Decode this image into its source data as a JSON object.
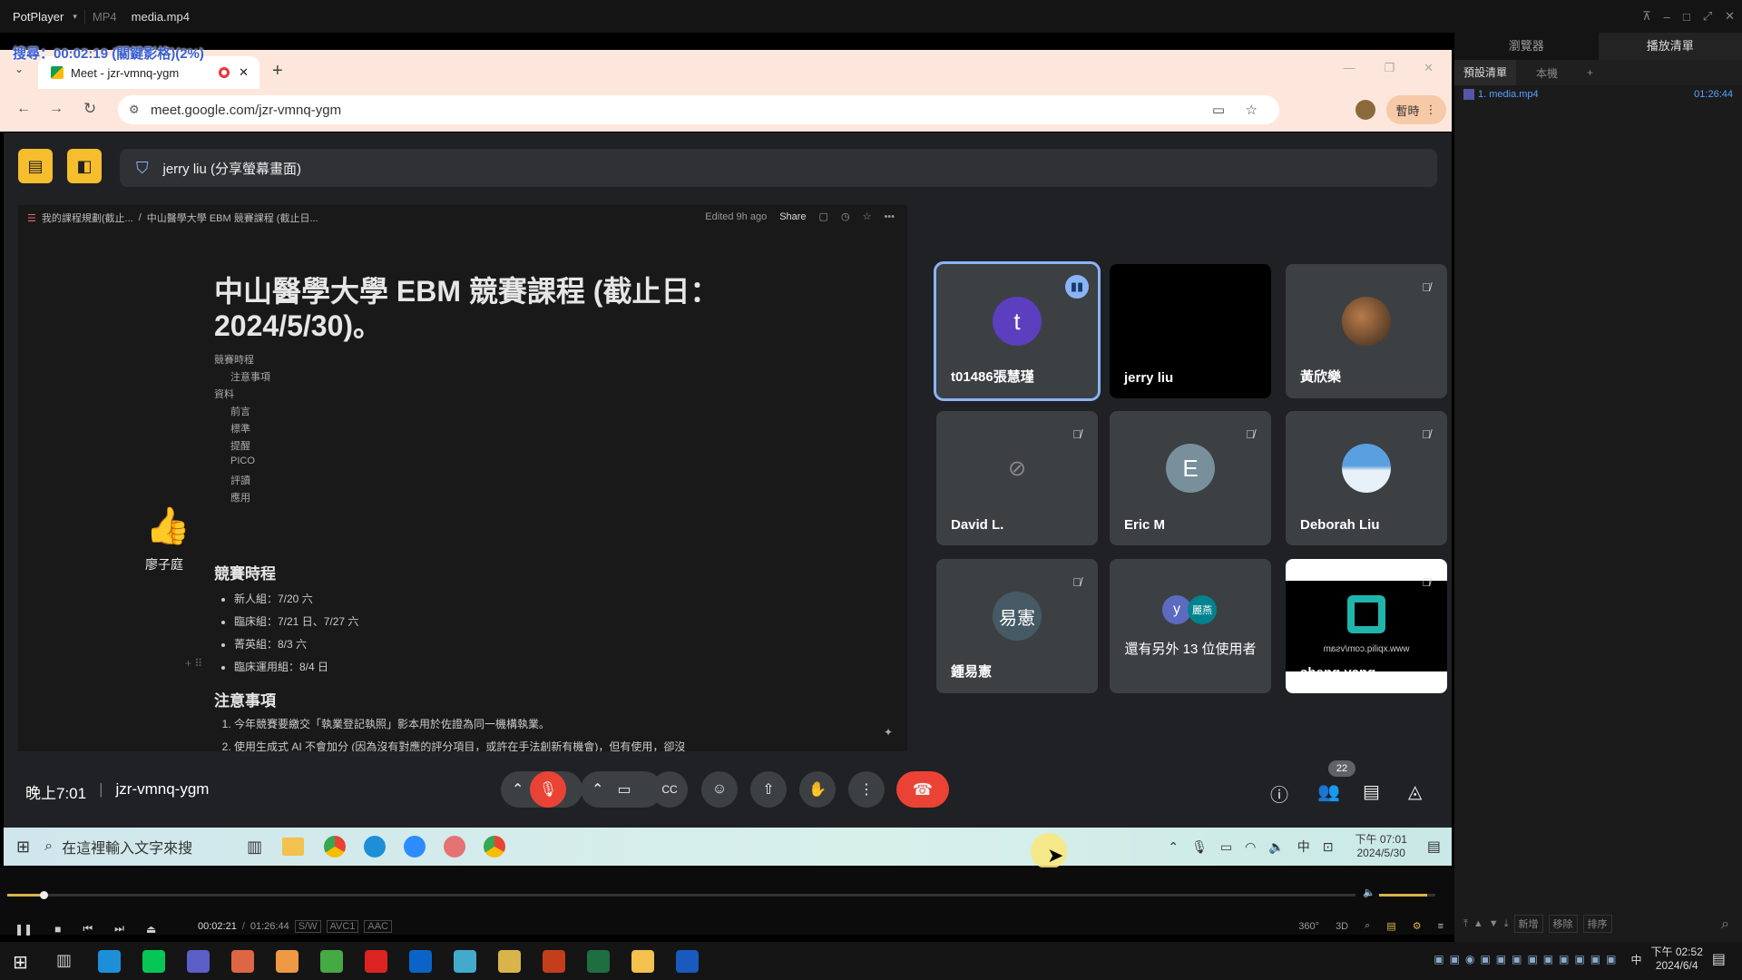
{
  "potplayer": {
    "app_name": "PotPlayer",
    "format": "MP4",
    "file": "media.mp4"
  },
  "osd": "搜尋：00:02:19 (關鍵影格)(2%)",
  "browser": {
    "tab_title": "Meet - jzr-vmnq-ygm",
    "url": "meet.google.com/jzr-vmnq-ygm",
    "pause_label": "暫時"
  },
  "meet": {
    "presenter": "jerry liu (分享螢幕畫面)",
    "time": "晚上7:01",
    "code": "jzr-vmnq-ygm",
    "people_count": "22",
    "reaction_name": "廖子庭",
    "tiles": [
      {
        "name": "t01486張慧瑾",
        "initial": "t",
        "color": "#5b3fbf"
      },
      {
        "name": "jerry liu"
      },
      {
        "name": "黃欣樂"
      },
      {
        "name": "David L."
      },
      {
        "name": "Eric M",
        "initial": "E",
        "color": "#78909c"
      },
      {
        "name": "Deborah Liu"
      },
      {
        "name": "鍾易憲",
        "initial": "易憲",
        "color": "#455a64"
      },
      {
        "name": "還有另外 13 位使用者",
        "i1": "y",
        "i2": "麗燕"
      },
      {
        "name": "sheng yang",
        "watermark": "www.xpiliq.com/vsam"
      }
    ]
  },
  "doc": {
    "breadcrumb1": "我的課程規劃(截止...",
    "breadcrumb2": "中山醫學大學 EBM 競賽課程 (截止日...",
    "edited": "Edited 9h ago",
    "share": "Share",
    "title_line1": "中山醫學大學 EBM 競賽課程 (截止日：",
    "title_line2": "2024/5/30)。",
    "toc": [
      {
        "t": "競賽時程",
        "indent": 0
      },
      {
        "t": "注意事項",
        "indent": 1
      },
      {
        "t": "資料",
        "indent": 0
      },
      {
        "t": "前言",
        "indent": 1
      },
      {
        "t": "標準",
        "indent": 1
      },
      {
        "t": "提醒",
        "indent": 1
      },
      {
        "t": "PICO",
        "indent": 1
      },
      {
        "t": "評讀",
        "indent": 1
      },
      {
        "t": "應用",
        "indent": 1
      }
    ],
    "h_schedule": "競賽時程",
    "schedule": [
      "新人組：7/20 六",
      "臨床組：7/21 日、7/27 六",
      "菁英組：8/3 六",
      "臨床運用組：8/4 日"
    ],
    "h_notes": "注意事項",
    "notes": [
      "今年競賽要繳交「執業登記執照」影本用於佐證為同一機構執業。",
      "使用生成式 AI 不會加分 (因為沒有對應的評分項目，或許在手法創新有機會)，但有使用，卻沒"
    ]
  },
  "taskbar1": {
    "search": "在這裡輸入文字來搜",
    "time": "下午 07:01",
    "date": "2024/5/30",
    "ime": "中",
    "notif": "7"
  },
  "player": {
    "elapsed": "00:02:21",
    "total": "01:26:44",
    "sw": "S/W",
    "vcodec": "AVC1",
    "acodec": "AAC",
    "mode_360": "360°",
    "mode_3d": "3D",
    "progress": 0.027,
    "volume": 0.85
  },
  "taskbar2": {
    "time": "下午 02:52",
    "date": "2024/6/4",
    "ime": "中"
  },
  "panel": {
    "tabs": [
      "瀏覽器",
      "播放清單"
    ],
    "subtabs": [
      "預設清單",
      "本機",
      "+"
    ],
    "item": "1. media.mp4",
    "item_dur": "01:26:44",
    "buttons": [
      "新增",
      "移除",
      "排序"
    ]
  }
}
